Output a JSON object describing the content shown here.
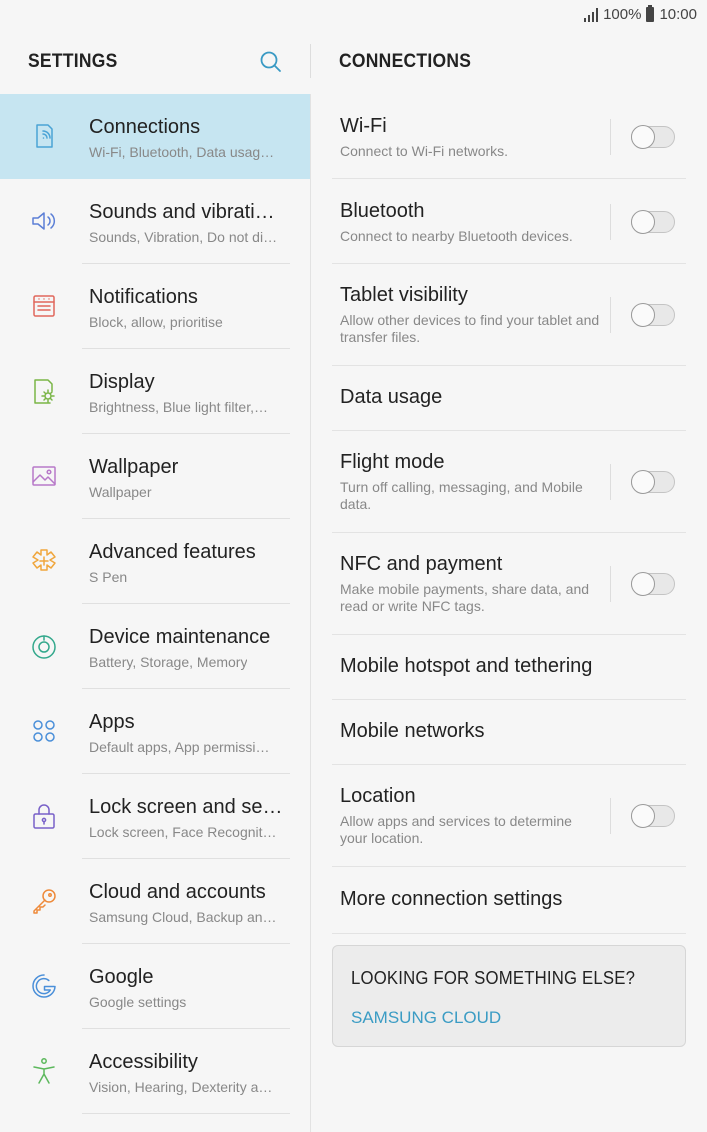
{
  "status": {
    "battery": "100%",
    "time": "10:00"
  },
  "left": {
    "title": "SETTINGS",
    "items": [
      {
        "title": "Connections",
        "subtitle": "Wi-Fi, Bluetooth, Data usag…",
        "icon": "connections-icon",
        "color": "#4aa3d6",
        "selected": true
      },
      {
        "title": "Sounds and vibrati…",
        "subtitle": "Sounds, Vibration, Do not di…",
        "icon": "speaker-icon",
        "color": "#5b7fd6"
      },
      {
        "title": "Notifications",
        "subtitle": "Block, allow, prioritise",
        "icon": "notifications-icon",
        "color": "#e0675b"
      },
      {
        "title": "Display",
        "subtitle": "Brightness, Blue light filter,…",
        "icon": "display-icon",
        "color": "#7ab547"
      },
      {
        "title": "Wallpaper",
        "subtitle": "Wallpaper",
        "icon": "wallpaper-icon",
        "color": "#b778c8"
      },
      {
        "title": "Advanced features",
        "subtitle": "S Pen",
        "icon": "advanced-features-icon",
        "color": "#f0a63c"
      },
      {
        "title": "Device maintenance",
        "subtitle": "Battery, Storage, Memory",
        "icon": "device-maintenance-icon",
        "color": "#33a88c"
      },
      {
        "title": "Apps",
        "subtitle": "Default apps, App permissi…",
        "icon": "apps-icon",
        "color": "#4a8fd9"
      },
      {
        "title": "Lock screen and se…",
        "subtitle": "Lock screen, Face Recognit…",
        "icon": "lock-icon",
        "color": "#7860c8"
      },
      {
        "title": "Cloud and accounts",
        "subtitle": "Samsung Cloud, Backup an…",
        "icon": "key-icon",
        "color": "#ee8a3a"
      },
      {
        "title": "Google",
        "subtitle": "Google settings",
        "icon": "google-icon",
        "color": "#4a8fd9"
      },
      {
        "title": "Accessibility",
        "subtitle": "Vision, Hearing, Dexterity a…",
        "icon": "accessibility-icon",
        "color": "#5cb85c"
      }
    ]
  },
  "right": {
    "title": "CONNECTIONS",
    "items": [
      {
        "title": "Wi-Fi",
        "subtitle": "Connect to Wi-Fi networks.",
        "toggle": false
      },
      {
        "title": "Bluetooth",
        "subtitle": "Connect to nearby Bluetooth devices.",
        "toggle": false
      },
      {
        "title": "Tablet visibility",
        "subtitle": "Allow other devices to find your tablet and transfer files.",
        "toggle": false
      },
      {
        "title": "Data usage"
      },
      {
        "title": "Flight mode",
        "subtitle": "Turn off calling, messaging, and Mobile data.",
        "toggle": false
      },
      {
        "title": "NFC and payment",
        "subtitle": "Make mobile payments, share data, and read or write NFC tags.",
        "toggle": false
      },
      {
        "title": "Mobile hotspot and tethering"
      },
      {
        "title": "Mobile networks"
      },
      {
        "title": "Location",
        "subtitle": "Allow apps and services to determine your location.",
        "toggle": false
      },
      {
        "title": "More connection settings"
      }
    ]
  },
  "card": {
    "title": "LOOKING FOR SOMETHING ELSE?",
    "link": "SAMSUNG CLOUD"
  }
}
